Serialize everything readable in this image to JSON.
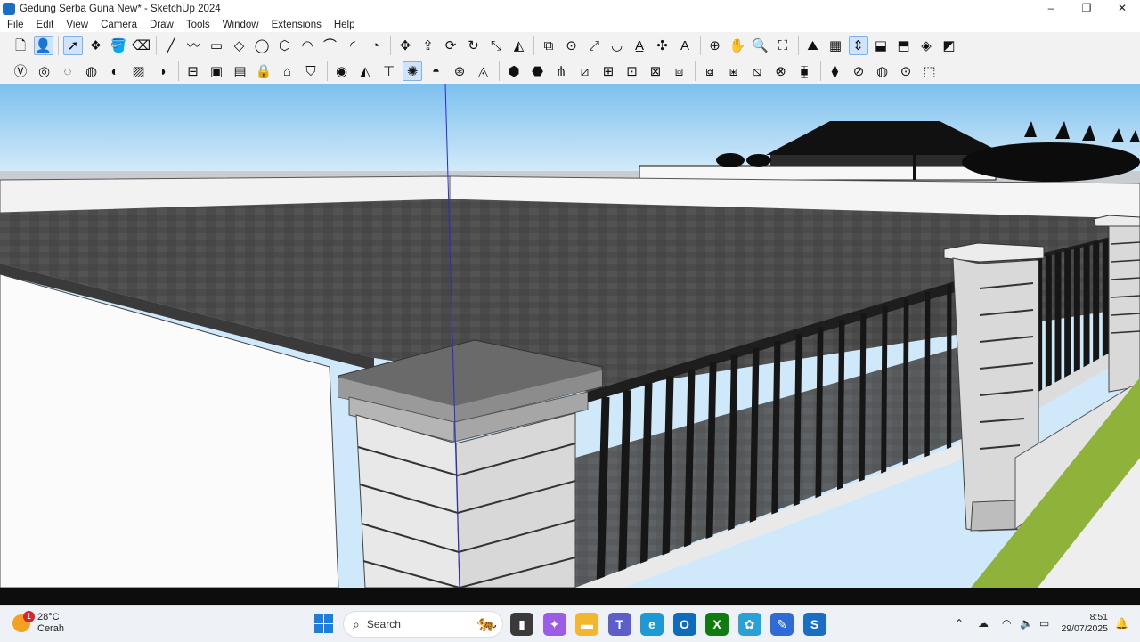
{
  "window": {
    "title": "Gedung Serba Guna New* - SketchUp 2024",
    "minimize": "–",
    "maximize": "❐",
    "close": "✕"
  },
  "menu": [
    "File",
    "Edit",
    "View",
    "Camera",
    "Draw",
    "Tools",
    "Window",
    "Extensions",
    "Help"
  ],
  "toolbar1": [
    {
      "name": "new-file-icon",
      "glyph": "🗋"
    },
    {
      "name": "account-icon",
      "glyph": "👤",
      "active": true
    },
    {
      "name": "select-tool-icon",
      "glyph": "➚",
      "active": true
    },
    {
      "name": "component-icon",
      "glyph": "❖"
    },
    {
      "name": "paint-bucket-icon",
      "glyph": "🪣"
    },
    {
      "name": "eraser-icon",
      "glyph": "⌫"
    },
    {
      "name": "line-tool-icon",
      "glyph": "╱"
    },
    {
      "name": "freehand-icon",
      "glyph": "〰"
    },
    {
      "name": "rectangle-icon",
      "glyph": "▭"
    },
    {
      "name": "rotated-rectangle-icon",
      "glyph": "◇"
    },
    {
      "name": "circle-icon",
      "glyph": "◯"
    },
    {
      "name": "polygon-icon",
      "glyph": "⬡"
    },
    {
      "name": "arc-icon",
      "glyph": "◠"
    },
    {
      "name": "arc-2pt-icon",
      "glyph": "⌒"
    },
    {
      "name": "arc-3pt-icon",
      "glyph": "◜"
    },
    {
      "name": "pie-icon",
      "glyph": "◔"
    },
    {
      "name": "move-icon",
      "glyph": "✥"
    },
    {
      "name": "push-pull-icon",
      "glyph": "⇪"
    },
    {
      "name": "rotate-icon",
      "glyph": "⟳"
    },
    {
      "name": "follow-me-icon",
      "glyph": "↻"
    },
    {
      "name": "scale-icon",
      "glyph": "⤡"
    },
    {
      "name": "flip-icon",
      "glyph": "◭"
    },
    {
      "name": "offset-icon",
      "glyph": "⧉"
    },
    {
      "name": "tape-measure-icon",
      "glyph": "⊙"
    },
    {
      "name": "dimension-icon",
      "glyph": "⤢"
    },
    {
      "name": "protractor-icon",
      "glyph": "◡"
    },
    {
      "name": "text-tool-icon",
      "glyph": "A̲"
    },
    {
      "name": "axes-icon",
      "glyph": "✣"
    },
    {
      "name": "3d-text-icon",
      "glyph": "A"
    },
    {
      "name": "orbit-icon",
      "glyph": "⊕"
    },
    {
      "name": "pan-icon",
      "glyph": "✋"
    },
    {
      "name": "zoom-icon",
      "glyph": "🔍"
    },
    {
      "name": "zoom-extents-icon",
      "glyph": "⛶"
    },
    {
      "name": "sandbox-contours-icon",
      "glyph": "⛰"
    },
    {
      "name": "sandbox-scratch-icon",
      "glyph": "▦"
    },
    {
      "name": "sandbox-smoove-icon",
      "glyph": "⇕",
      "active": true
    },
    {
      "name": "sandbox-stamp-icon",
      "glyph": "⬓"
    },
    {
      "name": "sandbox-drape-icon",
      "glyph": "⬒"
    },
    {
      "name": "sandbox-add-detail-icon",
      "glyph": "◈"
    },
    {
      "name": "sandbox-flip-edge-icon",
      "glyph": "◩"
    }
  ],
  "toolbar2": [
    {
      "name": "style-xray-icon",
      "glyph": "Ⓥ"
    },
    {
      "name": "style-backedges-icon",
      "glyph": "◎"
    },
    {
      "name": "style-wireframe-icon",
      "glyph": "◌"
    },
    {
      "name": "style-hidden-line-icon",
      "glyph": "◍"
    },
    {
      "name": "style-shaded-icon",
      "glyph": "◐"
    },
    {
      "name": "style-textured-icon",
      "glyph": "▨"
    },
    {
      "name": "style-monochrome-icon",
      "glyph": "◑"
    },
    {
      "name": "section-plane-icon",
      "glyph": "⊟"
    },
    {
      "name": "section-cut-icon",
      "glyph": "▣"
    },
    {
      "name": "section-fill-icon",
      "glyph": "▤"
    },
    {
      "name": "lock-icon",
      "glyph": "🔒"
    },
    {
      "name": "warehouse-icon",
      "glyph": "⌂"
    },
    {
      "name": "extension-warehouse-icon",
      "glyph": "⛉"
    },
    {
      "name": "sun-shadow-icon",
      "glyph": "◉"
    },
    {
      "name": "solid-tools-icon",
      "glyph": "◭"
    },
    {
      "name": "cone-icon",
      "glyph": "⊤"
    },
    {
      "name": "shadows-icon",
      "glyph": "✺",
      "active": true
    },
    {
      "name": "fog-icon",
      "glyph": "◓"
    },
    {
      "name": "fog-settings-icon",
      "glyph": "⊛"
    },
    {
      "name": "camera-position-icon",
      "glyph": "◬"
    },
    {
      "name": "iso-view-icon",
      "glyph": "⬢"
    },
    {
      "name": "top-view-icon",
      "glyph": "⬣"
    },
    {
      "name": "grass-icon",
      "glyph": "⋔"
    },
    {
      "name": "sandbox-plane-icon",
      "glyph": "⧄"
    },
    {
      "name": "front-view-icon",
      "glyph": "⊞"
    },
    {
      "name": "right-view-icon",
      "glyph": "⊡"
    },
    {
      "name": "back-view-icon",
      "glyph": "⊠"
    },
    {
      "name": "left-view-icon",
      "glyph": "⧈"
    },
    {
      "name": "outer-shell-icon",
      "glyph": "⧇"
    },
    {
      "name": "union-icon",
      "glyph": "⧆"
    },
    {
      "name": "subtract-icon",
      "glyph": "⧅"
    },
    {
      "name": "intersect-icon",
      "glyph": "⊗"
    },
    {
      "name": "trim-icon",
      "glyph": "⧯"
    },
    {
      "name": "split-icon",
      "glyph": "⧫"
    },
    {
      "name": "hide-icon",
      "glyph": "⊘"
    },
    {
      "name": "unhide-icon",
      "glyph": "◍"
    },
    {
      "name": "xray-cube-icon",
      "glyph": "⊙"
    },
    {
      "name": "move-cursor-icon",
      "glyph": "⬚"
    }
  ],
  "taskbar": {
    "weather": {
      "temp": "28°C",
      "desc": "Cerah",
      "notifications": "1"
    },
    "search_placeholder": "Search",
    "apps": [
      {
        "name": "task-view-icon",
        "glyph": "▮",
        "color": "#3a3a3a"
      },
      {
        "name": "copilot-icon",
        "glyph": "✦",
        "color": "#9b5de5"
      },
      {
        "name": "file-explorer-icon",
        "glyph": "▬",
        "color": "#f2b631"
      },
      {
        "name": "teams-icon",
        "glyph": "T",
        "color": "#5b5fc7"
      },
      {
        "name": "edge-icon",
        "glyph": "e",
        "color": "#1c9ad6"
      },
      {
        "name": "outlook-icon",
        "glyph": "O",
        "color": "#0f6cbd"
      },
      {
        "name": "xbox-icon",
        "glyph": "X",
        "color": "#107c10"
      },
      {
        "name": "color-app-icon",
        "glyph": "✿",
        "color": "#2aa0d8"
      },
      {
        "name": "pen-app-icon",
        "glyph": "✎",
        "color": "#2e6bd6"
      },
      {
        "name": "sketchup-icon",
        "glyph": "S",
        "color": "#1a6fc2"
      }
    ],
    "time": "8:51",
    "date": "29/07/2025"
  },
  "colors": {
    "sky_top": "#7fc2ee",
    "roof": "#4a4a4a",
    "wall": "#f4f4f4",
    "fence": "#222222",
    "grass": "#8fb33a",
    "axis_blue": "#2a2ad6"
  }
}
